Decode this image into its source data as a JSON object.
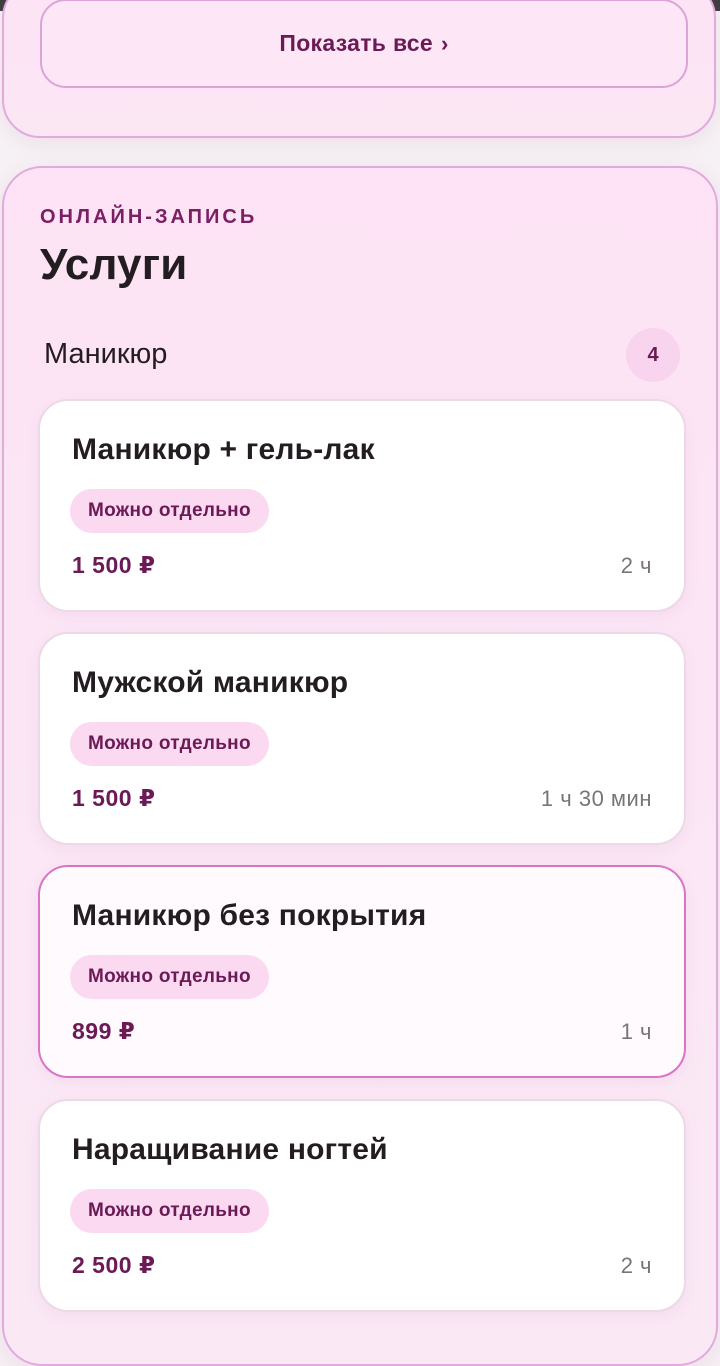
{
  "show_all": {
    "label": "Показать все",
    "chevron": "›"
  },
  "services_section": {
    "eyebrow": "ОНЛАЙН-ЗАПИСЬ",
    "title": "Услуги",
    "category": {
      "name": "Маникюр",
      "count": "4"
    },
    "items": [
      {
        "name": "Маникюр + гель-лак",
        "tag": "Можно отдельно",
        "price": "1 500 ₽",
        "duration": "2 ч",
        "selected": false
      },
      {
        "name": "Мужской маникюр",
        "tag": "Можно отдельно",
        "price": "1 500 ₽",
        "duration": "1 ч 30 мин",
        "selected": false
      },
      {
        "name": "Маникюр без покрытия",
        "tag": "Можно отдельно",
        "price": "899 ₽",
        "duration": "1 ч",
        "selected": true
      },
      {
        "name": "Наращивание ногтей",
        "tag": "Можно отдельно",
        "price": "2 500 ₽",
        "duration": "2 ч",
        "selected": false
      }
    ]
  },
  "colors": {
    "accent": "#6b1a55",
    "panel_border": "#e2a9dc",
    "selected_border": "#d975c6",
    "tag_bg": "#fbd9f0"
  }
}
